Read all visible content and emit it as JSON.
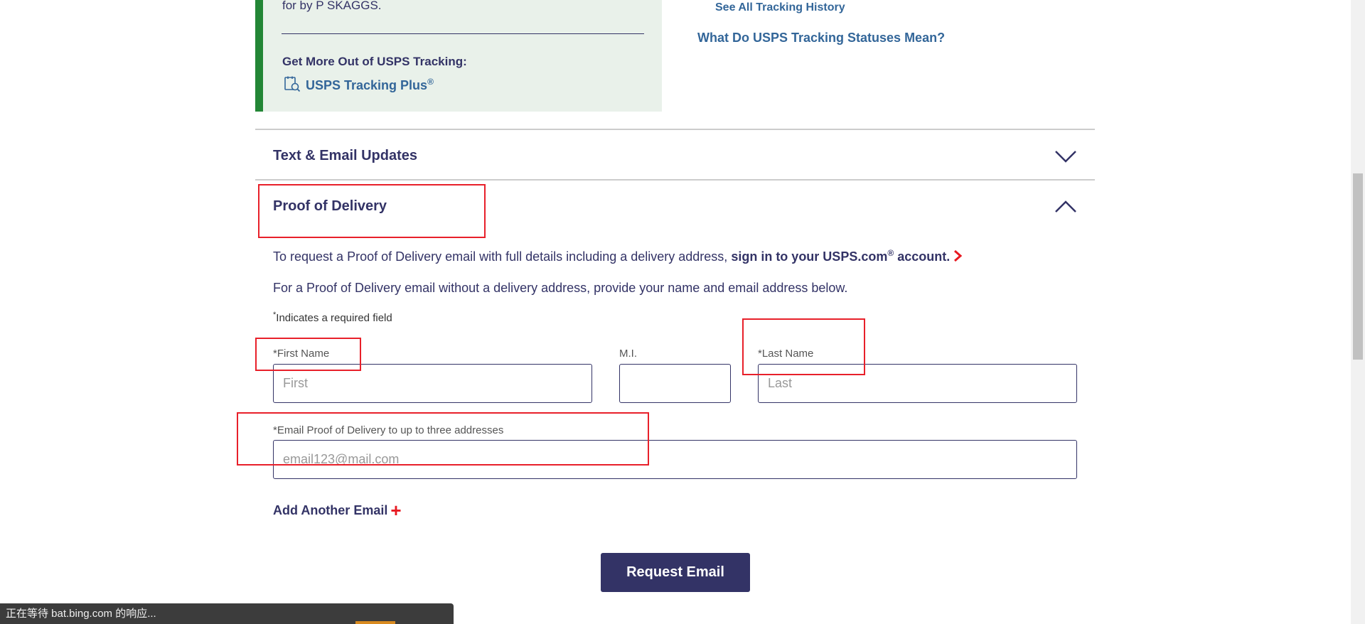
{
  "tracking_card": {
    "delivered_for_text": "for by P SKAGGS.",
    "get_more_label": "Get More Out of USPS Tracking:",
    "tracking_plus_label": "USPS Tracking Plus",
    "tracking_plus_sup": "®"
  },
  "side_links": {
    "see_all_history": "See All Tracking History",
    "statuses_meaning": "What Do USPS Tracking Statuses Mean?"
  },
  "accordions": {
    "text_email": {
      "title": "Text & Email Updates",
      "state": "collapsed"
    },
    "proof_delivery": {
      "title": "Proof of Delivery",
      "state": "expanded"
    }
  },
  "proof_of_delivery": {
    "intro_prefix": "To request a Proof of Delivery email with full details including a delivery address, ",
    "intro_link": "sign in to your USPS.com",
    "intro_link_sup": "®",
    "intro_link_suffix": " account.",
    "no_address_text": "For a Proof of Delivery email without a delivery address, provide your name and email address below.",
    "required_mark": "*",
    "required_note": "Indicates a required field",
    "first_name_label": "*First Name",
    "first_name_placeholder": "First",
    "mi_label": "M.I.",
    "mi_placeholder": "",
    "last_name_label": "*Last Name",
    "last_name_placeholder": "Last",
    "email_label": "*Email Proof of Delivery to up to three addresses",
    "email_placeholder": "email123@mail.com",
    "add_email_label": "Add Another Email",
    "add_email_icon": "+",
    "request_button": "Request Email"
  },
  "status_bar": {
    "text": "正在等待 bat.bing.com 的响应..."
  },
  "colors": {
    "navy": "#333366",
    "link_blue": "#336699",
    "accent_red": "#e71921",
    "card_green": "#238636",
    "card_bg": "#e9f1ea",
    "annotation_red": "#e8202a"
  }
}
